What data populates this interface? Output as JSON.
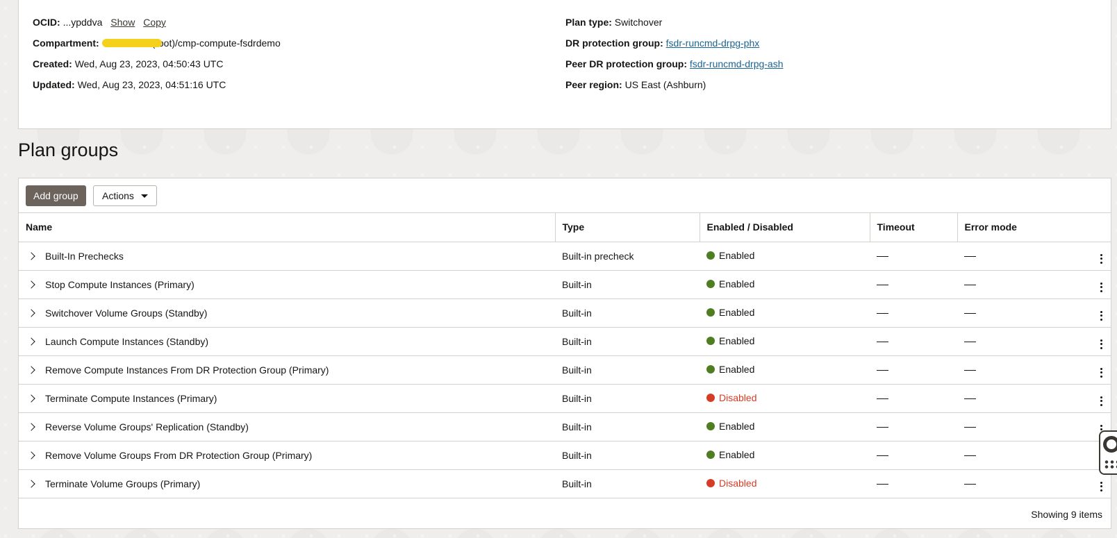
{
  "details": {
    "ocid": {
      "label": "OCID:",
      "value": "...ypddva",
      "show": "Show",
      "copy": "Copy"
    },
    "compartment": {
      "label": "Compartment:",
      "value": "(root)/cmp-compute-fsdrdemo"
    },
    "created": {
      "label": "Created:",
      "value": "Wed, Aug 23, 2023, 04:50:43 UTC"
    },
    "updated": {
      "label": "Updated:",
      "value": "Wed, Aug 23, 2023, 04:51:16 UTC"
    },
    "plan_type": {
      "label": "Plan type:",
      "value": "Switchover"
    },
    "dr_group": {
      "label": "DR protection group:",
      "value": "fsdr-runcmd-drpg-phx"
    },
    "peer_dr_group": {
      "label": "Peer DR protection group:",
      "value": "fsdr-runcmd-drpg-ash"
    },
    "peer_region": {
      "label": "Peer region:",
      "value": "US East (Ashburn)"
    }
  },
  "section_title": "Plan groups",
  "toolbar": {
    "add_group": "Add group",
    "actions": "Actions"
  },
  "table": {
    "headers": [
      "Name",
      "Type",
      "Enabled / Disabled",
      "Timeout",
      "Error mode"
    ],
    "rows": [
      {
        "name": "Built-In Prechecks",
        "type": "Built-in precheck",
        "status": "Enabled"
      },
      {
        "name": "Stop Compute Instances (Primary)",
        "type": "Built-in",
        "status": "Enabled"
      },
      {
        "name": "Switchover Volume Groups (Standby)",
        "type": "Built-in",
        "status": "Enabled"
      },
      {
        "name": "Launch Compute Instances (Standby)",
        "type": "Built-in",
        "status": "Enabled"
      },
      {
        "name": "Remove Compute Instances From DR Protection Group (Primary)",
        "type": "Built-in",
        "status": "Enabled"
      },
      {
        "name": "Terminate Compute Instances (Primary)",
        "type": "Built-in",
        "status": "Disabled"
      },
      {
        "name": "Reverse Volume Groups' Replication (Standby)",
        "type": "Built-in",
        "status": "Enabled"
      },
      {
        "name": "Remove Volume Groups From DR Protection Group (Primary)",
        "type": "Built-in",
        "status": "Enabled"
      },
      {
        "name": "Terminate Volume Groups (Primary)",
        "type": "Built-in",
        "status": "Disabled"
      }
    ]
  },
  "footer": {
    "showing": "Showing 9 items"
  },
  "colors": {
    "enabled": "#4f7d21",
    "disabled": "#d63b25",
    "link": "#1a6594",
    "primary_button": "#6b635c"
  },
  "icons": {
    "expand": "chevron-right-icon",
    "row_actions": "kebab-menu-icon",
    "help": "lifebuoy-icon"
  }
}
